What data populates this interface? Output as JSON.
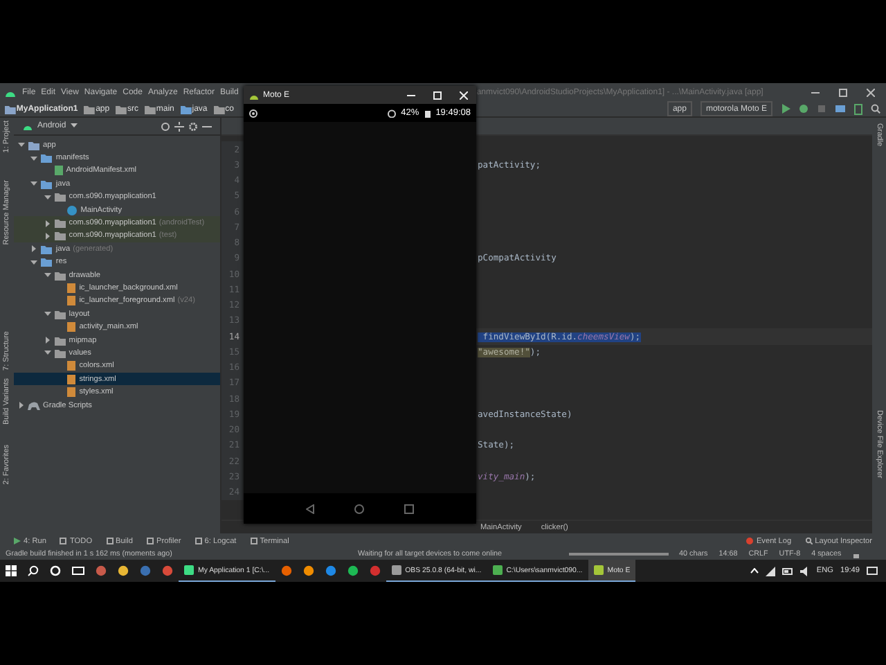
{
  "window": {
    "title": "anmvict090\\AndroidStudioProjects\\MyApplication1] - ...\\MainActivity.java [app]"
  },
  "menu": [
    "File",
    "Edit",
    "View",
    "Navigate",
    "Code",
    "Analyze",
    "Refactor",
    "Build"
  ],
  "breadcrumb": [
    "MyApplication1",
    "app",
    "src",
    "main",
    "java",
    "co"
  ],
  "run_config": {
    "module": "app",
    "device": "motorola Moto E"
  },
  "project_view": {
    "mode": "Android"
  },
  "left_tools": [
    "1: Project",
    "Resource Manager",
    "7: Structure",
    "Build Variants",
    "2: Favorites"
  ],
  "right_tools": [
    "Gradle",
    "Device File Explorer"
  ],
  "tree": [
    {
      "kind": "module",
      "label": "app",
      "expanded": true,
      "selected": false,
      "children": [
        {
          "kind": "folder",
          "label": "manifests",
          "expanded": true,
          "selected": false,
          "children": [
            {
              "kind": "manifest",
              "label": "AndroidManifest.xml",
              "selected": false
            }
          ]
        },
        {
          "kind": "folder",
          "label": "java",
          "expanded": true,
          "selected": false,
          "children": [
            {
              "kind": "package",
              "label": "com.s090.myapplication1",
              "expanded": true,
              "selected": false,
              "children": [
                {
                  "kind": "class",
                  "label": "MainActivity",
                  "selected": false
                }
              ]
            },
            {
              "kind": "test-package",
              "label": "com.s090.myapplication1",
              "suffix": "(androidTest)",
              "expanded": false,
              "selected": false
            },
            {
              "kind": "test-package",
              "label": "com.s090.myapplication1",
              "suffix": "(test)",
              "expanded": false,
              "selected": false
            }
          ]
        },
        {
          "kind": "folder",
          "label": "java",
          "suffix": "(generated)",
          "expanded": false,
          "selected": false
        },
        {
          "kind": "folder",
          "label": "res",
          "expanded": true,
          "selected": false,
          "children": [
            {
              "kind": "package",
              "label": "drawable",
              "expanded": true,
              "selected": false,
              "children": [
                {
                  "kind": "xml",
                  "label": "ic_launcher_background.xml",
                  "selected": false
                },
                {
                  "kind": "xml",
                  "label": "ic_launcher_foreground.xml",
                  "suffix": "(v24)",
                  "selected": false
                }
              ]
            },
            {
              "kind": "package",
              "label": "layout",
              "expanded": true,
              "selected": false,
              "children": [
                {
                  "kind": "xml",
                  "label": "activity_main.xml",
                  "selected": false
                }
              ]
            },
            {
              "kind": "package",
              "label": "mipmap",
              "expanded": false,
              "selected": false
            },
            {
              "kind": "package",
              "label": "values",
              "expanded": true,
              "selected": false,
              "children": [
                {
                  "kind": "xml",
                  "label": "colors.xml",
                  "selected": false
                },
                {
                  "kind": "xml",
                  "label": "strings.xml",
                  "selected": true
                },
                {
                  "kind": "xml",
                  "label": "styles.xml",
                  "selected": false
                }
              ]
            }
          ]
        }
      ]
    },
    {
      "kind": "gradle",
      "label": "Gradle Scripts",
      "expanded": false,
      "selected": false
    }
  ],
  "editor": {
    "lines": [
      {
        "number": "2",
        "current": false
      },
      {
        "number": "3",
        "current": false,
        "code": [
          {
            "text": "patActivity;",
            "kind": "plain"
          }
        ]
      },
      {
        "number": "4",
        "current": false
      },
      {
        "number": "5",
        "current": false
      },
      {
        "number": "6",
        "current": false
      },
      {
        "number": "7",
        "current": false
      },
      {
        "number": "8",
        "current": false
      },
      {
        "number": "9",
        "current": false,
        "code": [
          {
            "text": "pCompatActivity",
            "kind": "plain"
          }
        ]
      },
      {
        "number": "10",
        "current": false
      },
      {
        "number": "11",
        "current": false
      },
      {
        "number": "12",
        "current": false
      },
      {
        "number": "13",
        "current": false
      },
      {
        "number": "14",
        "current": true,
        "code": [
          {
            "text": " findViewById(R.id.",
            "kind": "selected"
          },
          {
            "text": "cheemsView",
            "kind": "selected-field"
          },
          {
            "text": ");",
            "kind": "selected"
          }
        ]
      },
      {
        "number": "15",
        "current": false,
        "code": [
          {
            "text": "\"awesome!\"",
            "kind": "match"
          },
          {
            "text": ");",
            "kind": "plain"
          }
        ]
      },
      {
        "number": "16",
        "current": false
      },
      {
        "number": "17",
        "current": false
      },
      {
        "number": "18",
        "current": false
      },
      {
        "number": "19",
        "current": false,
        "code": [
          {
            "text": "avedInstanceState)",
            "kind": "plain"
          }
        ]
      },
      {
        "number": "20",
        "current": false
      },
      {
        "number": "21",
        "current": false,
        "code": [
          {
            "text": "State);",
            "kind": "plain"
          }
        ]
      },
      {
        "number": "22",
        "current": false
      },
      {
        "number": "23",
        "current": false,
        "code": [
          {
            "text": "vity_main",
            "kind": "field"
          },
          {
            "text": ");",
            "kind": "plain"
          }
        ]
      },
      {
        "number": "24",
        "current": false
      }
    ],
    "breadcrumb": [
      "MainActivity",
      "clicker()"
    ]
  },
  "emulator": {
    "title": "Moto E",
    "battery": "42%",
    "time": "19:49:08"
  },
  "tool_tabs": [
    "4: Run",
    "TODO",
    "Build",
    "Profiler",
    "6: Logcat",
    "Terminal"
  ],
  "right_tabs": [
    "Event Log",
    "Layout Inspector"
  ],
  "status": {
    "message": "Gradle build finished in 1 s 162 ms (moments ago)",
    "progress_text": "Waiting for all target devices to come online",
    "level": 1,
    "fields": [
      "40 chars",
      "14:68",
      "CRLF",
      "UTF-8",
      "4 spaces"
    ]
  },
  "taskbar": {
    "items": [
      {
        "kind": "pinned",
        "color": "#c85a4a"
      },
      {
        "kind": "pinned",
        "color": "#e8b634"
      },
      {
        "kind": "pinned",
        "color": "#3a6fb0"
      },
      {
        "kind": "pinned",
        "color": "#d84a3a"
      },
      {
        "kind": "window",
        "label": "My Application 1 [C:\\...",
        "color": "#3ddc84",
        "selected": false
      },
      {
        "kind": "pinned",
        "color": "#e66000"
      },
      {
        "kind": "pinned",
        "color": "#f08c00"
      },
      {
        "kind": "pinned",
        "color": "#1e88e5"
      },
      {
        "kind": "pinned",
        "color": "#1db954"
      },
      {
        "kind": "pinned",
        "color": "#d32f2f"
      },
      {
        "kind": "window",
        "label": "OBS 25.0.8 (64-bit, wi...",
        "color": "#9a9a9a",
        "selected": false
      },
      {
        "kind": "window",
        "label": "C:\\Users\\sanmvict090...",
        "color": "#4caf50",
        "selected": false
      },
      {
        "kind": "window",
        "label": "Moto E",
        "color": "#a4c639",
        "selected": true
      }
    ],
    "lang": "ENG",
    "time": "19:49"
  }
}
